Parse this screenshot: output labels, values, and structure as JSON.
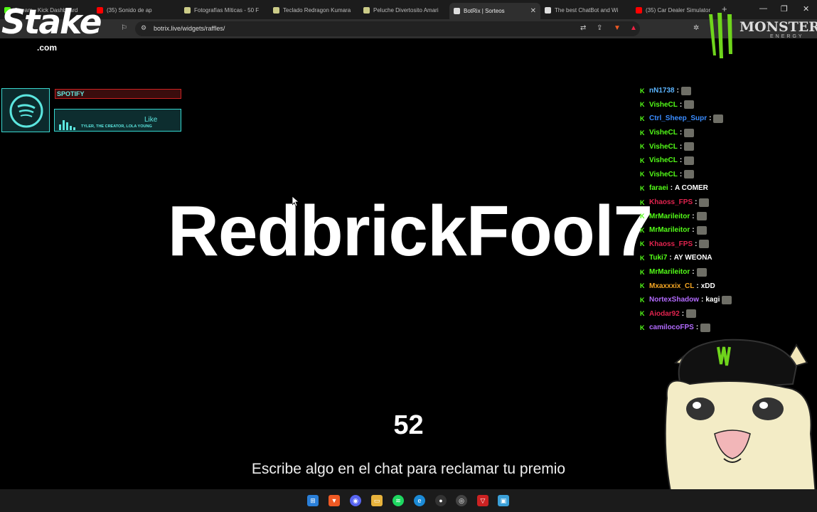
{
  "browser": {
    "tabs": [
      {
        "label": "Stream - Kick Dashboard",
        "color": "#53fc18",
        "active": false
      },
      {
        "label": "(35) Sonido de ap",
        "color": "#ff0000",
        "active": false
      },
      {
        "label": "Fotografías Míticas - 50 F",
        "color": "#cccc88",
        "active": false
      },
      {
        "label": "Teclado Redragon Kumara",
        "color": "#cccc88",
        "active": false
      },
      {
        "label": "Peluche Divertosito Amari",
        "color": "#cccc88",
        "active": false
      },
      {
        "label": "BotRix | Sorteos",
        "color": "#dddddd",
        "active": true
      },
      {
        "label": "The best ChatBot and Wi",
        "color": "#dddddd",
        "active": false
      },
      {
        "label": "(35) Car Dealer Simulator",
        "color": "#ff0000",
        "active": false
      }
    ],
    "url": "botrix.live/widgets/raffles/"
  },
  "overlay": {
    "stake_logo": "Stake",
    "stake_domain": ".com",
    "monster_word": "MONSTER",
    "monster_sub": "ENERGY"
  },
  "spotify": {
    "title": "SPOTIFY",
    "song": "Like",
    "artist": "TYLER, THE CREATOR, LOLA YOUNG"
  },
  "raffle": {
    "winner": "RedbrickFool7",
    "countdown": "52",
    "instruction": "Escribe algo en el chat para reclamar tu premio"
  },
  "chat": [
    {
      "user": "nN1738",
      "color": "#5bb4ff",
      "text": "",
      "emote": true
    },
    {
      "user": "VisheCL",
      "color": "#53fc18",
      "text": "",
      "emote": true
    },
    {
      "user": "Ctrl_Sheep_Supr",
      "color": "#3a8cff",
      "text": "",
      "emote": true
    },
    {
      "user": "VisheCL",
      "color": "#53fc18",
      "text": "",
      "emote": true
    },
    {
      "user": "VisheCL",
      "color": "#53fc18",
      "text": "",
      "emote": true
    },
    {
      "user": "VisheCL",
      "color": "#53fc18",
      "text": "",
      "emote": true
    },
    {
      "user": "VisheCL",
      "color": "#53fc18",
      "text": "",
      "emote": true
    },
    {
      "user": "faraei",
      "color": "#53fc18",
      "text": "A COMER",
      "emote": false
    },
    {
      "user": "Khaoss_FPS",
      "color": "#e0234e",
      "text": "",
      "emote": true
    },
    {
      "user": "MrMarileitor",
      "color": "#53fc18",
      "text": "",
      "emote": true
    },
    {
      "user": "MrMarileitor",
      "color": "#53fc18",
      "text": "",
      "emote": true
    },
    {
      "user": "Khaoss_FPS",
      "color": "#e0234e",
      "text": "",
      "emote": true
    },
    {
      "user": "Tuki7",
      "color": "#53fc18",
      "text": "AY WEONA",
      "emote": false
    },
    {
      "user": "MrMarileitor",
      "color": "#53fc18",
      "text": "",
      "emote": true
    },
    {
      "user": "Mxaxxxix_CL",
      "color": "#f5a623",
      "text": "xDD",
      "emote": false
    },
    {
      "user": "NortexShadow",
      "color": "#b36bff",
      "text": "kagi",
      "emote": true
    },
    {
      "user": "Aiodar92",
      "color": "#e0234e",
      "text": "",
      "emote": true
    },
    {
      "user": "camilocoFPS",
      "color": "#b36bff",
      "text": "",
      "emote": true
    }
  ]
}
